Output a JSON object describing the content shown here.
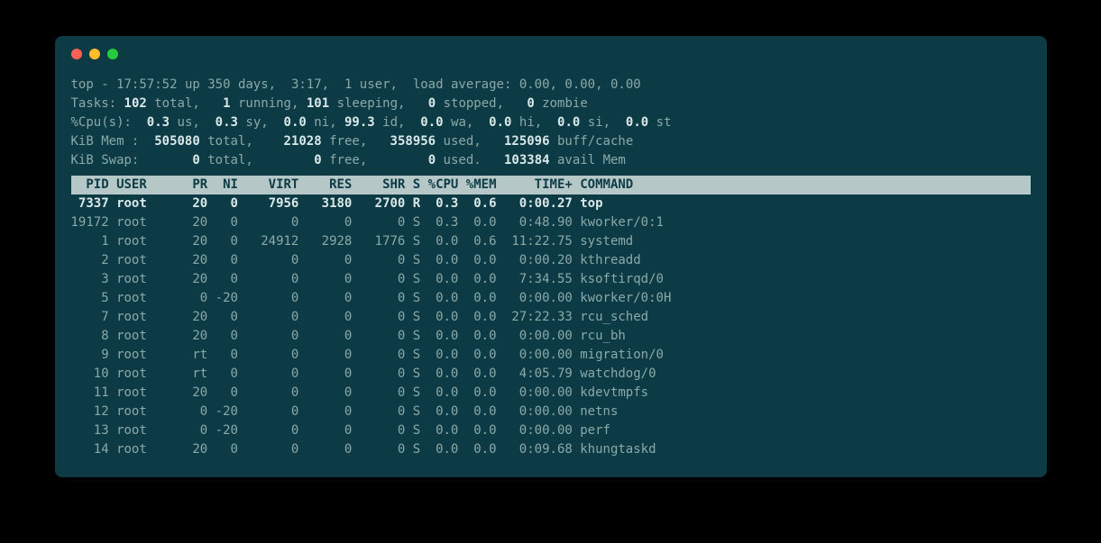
{
  "summary": {
    "line1": {
      "prefix": "top - ",
      "time": "17:57:52",
      "uptime": " up 350 days,  3:17,  ",
      "users": "1 user",
      "load_label": ",  load average: ",
      "load": "0.00, 0.00, 0.00"
    },
    "tasks": {
      "label": "Tasks: ",
      "total": "102",
      "total_lbl": " total,   ",
      "running": "1",
      "running_lbl": " running, ",
      "sleeping": "101",
      "sleeping_lbl": " sleeping,   ",
      "stopped": "0",
      "stopped_lbl": " stopped,   ",
      "zombie": "0",
      "zombie_lbl": " zombie"
    },
    "cpu": {
      "label": "%Cpu(s):  ",
      "us": "0.3",
      "us_lbl": " us,  ",
      "sy": "0.3",
      "sy_lbl": " sy,  ",
      "ni": "0.0",
      "ni_lbl": " ni, ",
      "id": "99.3",
      "id_lbl": " id,  ",
      "wa": "0.0",
      "wa_lbl": " wa,  ",
      "hi": "0.0",
      "hi_lbl": " hi,  ",
      "si": "0.0",
      "si_lbl": " si,  ",
      "st": "0.0",
      "st_lbl": " st"
    },
    "mem": {
      "label": "KiB Mem :  ",
      "total": "505080",
      "total_lbl": " total,    ",
      "free": "21028",
      "free_lbl": " free,   ",
      "used": "358956",
      "used_lbl": " used,   ",
      "buff": "125096",
      "buff_lbl": " buff/cache"
    },
    "swap": {
      "label": "KiB Swap:       ",
      "total": "0",
      "total_lbl": " total,        ",
      "free": "0",
      "free_lbl": " free,        ",
      "used": "0",
      "used_lbl": " used.   ",
      "avail": "103384",
      "avail_lbl": " avail Mem"
    }
  },
  "header": "  PID USER      PR  NI    VIRT    RES    SHR S %CPU %MEM     TIME+ COMMAND",
  "processes": [
    {
      "pid": "7337",
      "user": "root",
      "pr": "20",
      "ni": "0",
      "virt": "7956",
      "res": "3180",
      "shr": "2700",
      "s": "R",
      "cpu": "0.3",
      "mem": "0.6",
      "time": "0:00.27",
      "cmd": "top",
      "bold": true
    },
    {
      "pid": "19172",
      "user": "root",
      "pr": "20",
      "ni": "0",
      "virt": "0",
      "res": "0",
      "shr": "0",
      "s": "S",
      "cpu": "0.3",
      "mem": "0.0",
      "time": "0:48.90",
      "cmd": "kworker/0:1"
    },
    {
      "pid": "1",
      "user": "root",
      "pr": "20",
      "ni": "0",
      "virt": "24912",
      "res": "2928",
      "shr": "1776",
      "s": "S",
      "cpu": "0.0",
      "mem": "0.6",
      "time": "11:22.75",
      "cmd": "systemd"
    },
    {
      "pid": "2",
      "user": "root",
      "pr": "20",
      "ni": "0",
      "virt": "0",
      "res": "0",
      "shr": "0",
      "s": "S",
      "cpu": "0.0",
      "mem": "0.0",
      "time": "0:00.20",
      "cmd": "kthreadd"
    },
    {
      "pid": "3",
      "user": "root",
      "pr": "20",
      "ni": "0",
      "virt": "0",
      "res": "0",
      "shr": "0",
      "s": "S",
      "cpu": "0.0",
      "mem": "0.0",
      "time": "7:34.55",
      "cmd": "ksoftirqd/0"
    },
    {
      "pid": "5",
      "user": "root",
      "pr": "0",
      "ni": "-20",
      "virt": "0",
      "res": "0",
      "shr": "0",
      "s": "S",
      "cpu": "0.0",
      "mem": "0.0",
      "time": "0:00.00",
      "cmd": "kworker/0:0H"
    },
    {
      "pid": "7",
      "user": "root",
      "pr": "20",
      "ni": "0",
      "virt": "0",
      "res": "0",
      "shr": "0",
      "s": "S",
      "cpu": "0.0",
      "mem": "0.0",
      "time": "27:22.33",
      "cmd": "rcu_sched"
    },
    {
      "pid": "8",
      "user": "root",
      "pr": "20",
      "ni": "0",
      "virt": "0",
      "res": "0",
      "shr": "0",
      "s": "S",
      "cpu": "0.0",
      "mem": "0.0",
      "time": "0:00.00",
      "cmd": "rcu_bh"
    },
    {
      "pid": "9",
      "user": "root",
      "pr": "rt",
      "ni": "0",
      "virt": "0",
      "res": "0",
      "shr": "0",
      "s": "S",
      "cpu": "0.0",
      "mem": "0.0",
      "time": "0:00.00",
      "cmd": "migration/0"
    },
    {
      "pid": "10",
      "user": "root",
      "pr": "rt",
      "ni": "0",
      "virt": "0",
      "res": "0",
      "shr": "0",
      "s": "S",
      "cpu": "0.0",
      "mem": "0.0",
      "time": "4:05.79",
      "cmd": "watchdog/0"
    },
    {
      "pid": "11",
      "user": "root",
      "pr": "20",
      "ni": "0",
      "virt": "0",
      "res": "0",
      "shr": "0",
      "s": "S",
      "cpu": "0.0",
      "mem": "0.0",
      "time": "0:00.00",
      "cmd": "kdevtmpfs"
    },
    {
      "pid": "12",
      "user": "root",
      "pr": "0",
      "ni": "-20",
      "virt": "0",
      "res": "0",
      "shr": "0",
      "s": "S",
      "cpu": "0.0",
      "mem": "0.0",
      "time": "0:00.00",
      "cmd": "netns"
    },
    {
      "pid": "13",
      "user": "root",
      "pr": "0",
      "ni": "-20",
      "virt": "0",
      "res": "0",
      "shr": "0",
      "s": "S",
      "cpu": "0.0",
      "mem": "0.0",
      "time": "0:00.00",
      "cmd": "perf"
    },
    {
      "pid": "14",
      "user": "root",
      "pr": "20",
      "ni": "0",
      "virt": "0",
      "res": "0",
      "shr": "0",
      "s": "S",
      "cpu": "0.0",
      "mem": "0.0",
      "time": "0:09.68",
      "cmd": "khungtaskd"
    }
  ]
}
